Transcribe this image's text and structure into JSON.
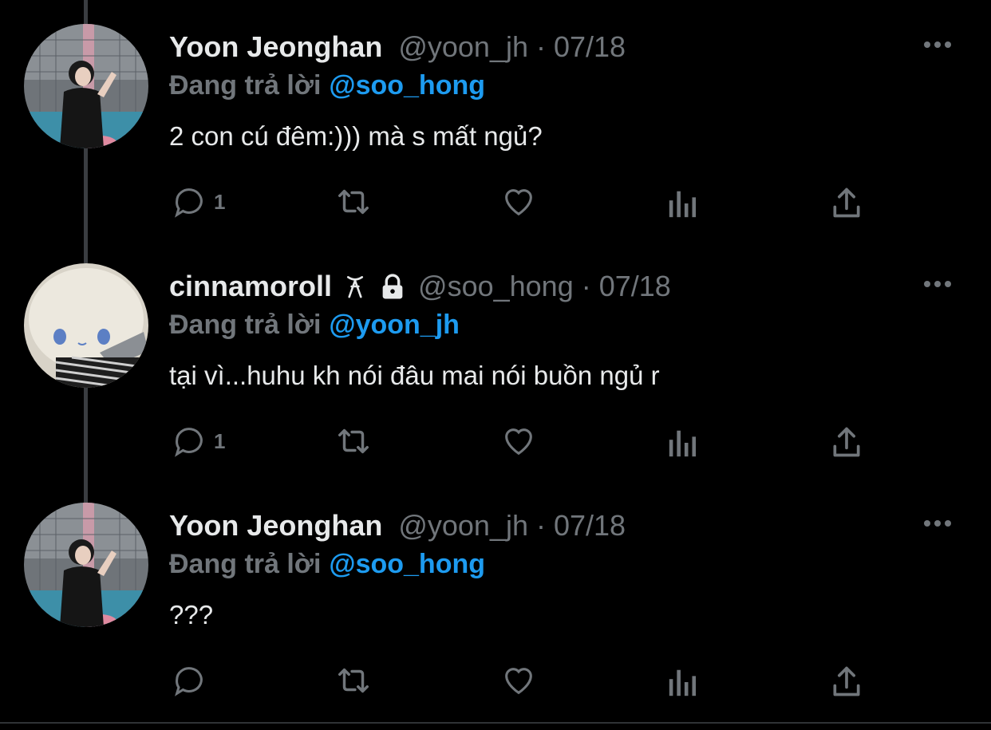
{
  "tweets": [
    {
      "name": "Yoon Jeonghan",
      "handle_date": "@yoon_jh · 07/18",
      "reply_prefix": "Đang trả lời",
      "reply_to": "@soo_hong",
      "text": "2 con cú đêm:))) mà s mất ngủ?",
      "reply_count": "1",
      "avatar": "avatar-person"
    },
    {
      "name": "cinnamoroll",
      "name_badges": [
        "ribbon-icon",
        "lock-icon"
      ],
      "handle_date": "@soo_hong · 07/18",
      "reply_prefix": "Đang trả lời",
      "reply_to": "@yoon_jh",
      "text": "tại vì...huhu kh nói đâu mai nói buồn ngủ r",
      "reply_count": "1",
      "avatar": "avatar-plush"
    },
    {
      "name": "Yoon Jeonghan",
      "handle_date": "@yoon_jh · 07/18",
      "reply_prefix": "Đang trả lời",
      "reply_to": "@soo_hong",
      "text": "???",
      "reply_count": "",
      "avatar": "avatar-person"
    }
  ],
  "colors": {
    "background": "#000000",
    "primary_text": "#e7e9ea",
    "secondary_text": "#71767b",
    "accent": "#1d9bf0",
    "thread_line": "#3a3d41"
  }
}
